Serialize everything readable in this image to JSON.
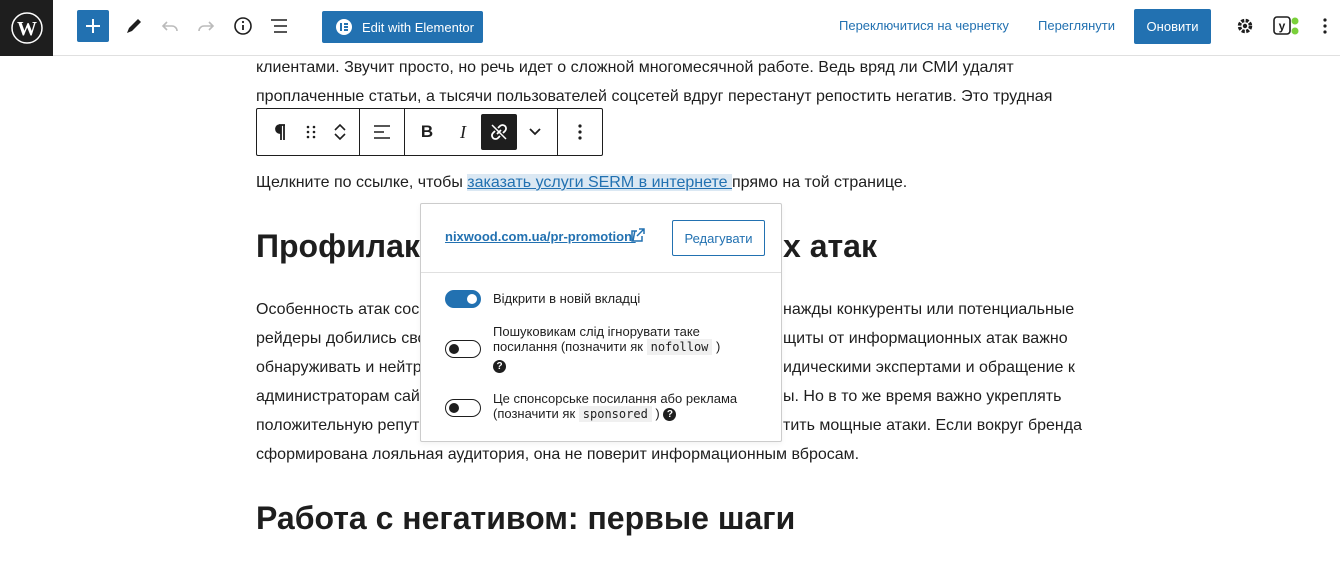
{
  "header": {
    "elementor_label": "Edit with Elementor",
    "switch_draft_label": "Переключитися на чернетку",
    "preview_label": "Переглянути",
    "update_label": "Оновити"
  },
  "content": {
    "top_line1": "клиентами. Звучит просто, но речь идет о сложной многомесячной работе. Ведь вряд ли СМИ удалят",
    "top_line2": "проплаченные статьи, а тысячи пользователей соцсетей вдруг перестанут репостить негатив. Это трудная",
    "link_line_before": "Щелкните по ссылке, чтобы ",
    "link_text": "заказать услуги SERM в интернете ",
    "link_line_after": "прямо на той странице.",
    "heading1_left": "Профилакт",
    "heading1_right": "х атак",
    "body_lines": [
      [
        "Особенность атак сос",
        "нажды конкуренты или потенциальные"
      ],
      [
        "рейдеры добились сво",
        "щиты от информационных атак важно"
      ],
      [
        "обнаруживать и нейтр",
        "идическими экспертами и обращение к"
      ],
      [
        "администраторам сай",
        "ы. Но в то же время важно укреплять"
      ],
      [
        "положительную репут",
        "тить мощные атаки. Если вокруг бренда"
      ],
      [
        "сформирована лояльная аудитория, она не поверит информационным вбросам.",
        ""
      ]
    ],
    "heading2": "Работа с негативом: первые шаги"
  },
  "popover": {
    "url": "nixwood.com.ua/pr-promotion/",
    "edit_label": "Редагувати",
    "opt_new_tab": "Відкрити в новій вкладці",
    "opt_nofollow_text": "Пошуковикам слід ігнорувати таке посилання (позначити як",
    "opt_nofollow_code": "nofollow",
    "opt_sponsored_text": "Це спонсорське посилання або реклама (позначити як",
    "opt_sponsored_code": "sponsored",
    "close_paren": ")",
    "help_glyph": "?"
  },
  "colors": {
    "accent": "#2271b1",
    "dark": "#1e1e1e"
  }
}
